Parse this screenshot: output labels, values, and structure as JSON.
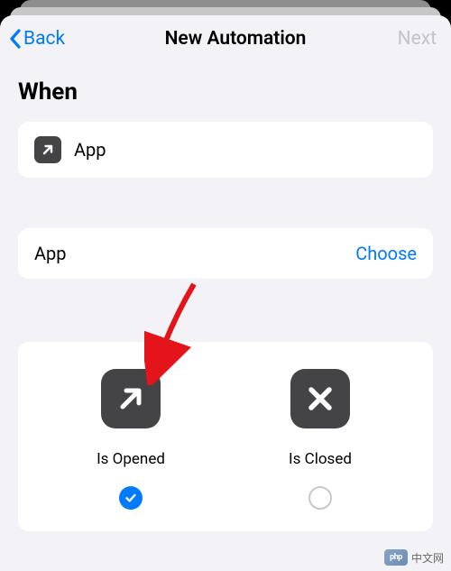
{
  "nav": {
    "back": "Back",
    "title": "New Automation",
    "next": "Next"
  },
  "section_header": "When",
  "trigger": {
    "label": "App"
  },
  "selector": {
    "label": "App",
    "action": "Choose"
  },
  "options": {
    "opened": {
      "label": "Is Opened",
      "checked": true
    },
    "closed": {
      "label": "Is Closed",
      "checked": false
    }
  },
  "watermark": {
    "logo": "php",
    "text": "中文网"
  }
}
